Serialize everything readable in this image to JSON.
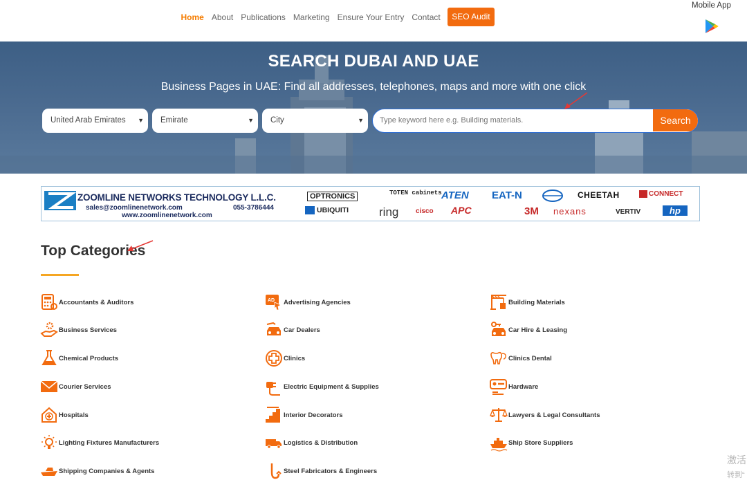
{
  "nav": {
    "links": [
      "Home",
      "About",
      "Publications",
      "Marketing",
      "Ensure Your Entry",
      "Contact"
    ],
    "seo_label": "SEO Audit",
    "mobile_app": "Mobile App"
  },
  "hero": {
    "title": "SEARCH DUBAI AND UAE",
    "subtitle": "Business Pages in UAE: Find all addresses, telephones, maps and more with one click",
    "country": "United Arab Emirates",
    "emirate": "Emirate",
    "city": "City",
    "search_placeholder": "Type keyword here e.g. Building materials.",
    "search_label": "Search"
  },
  "banner": {
    "company": "ZOOMLINE NETWORKS TECHNOLOGY L.L.C.",
    "email": "sales@zoomlinenetwork.com",
    "phone": "055-3786444",
    "web": "www.zoomlinenetwork.com",
    "brands_top": [
      "OPTRONICS",
      "TOTEN cabinets",
      "ATEN",
      "EAT-N",
      "CHEETAH",
      "CONNECT"
    ],
    "brands_bottom": [
      "UBIQUITI",
      "ring",
      "cisco",
      "APC",
      "3M",
      "nexans",
      "VERTIV",
      "hp"
    ]
  },
  "categories": {
    "title": "Top Categories",
    "items": [
      {
        "label": "Accountants & Auditors",
        "icon": "calculator-icon"
      },
      {
        "label": "Advertising Agencies",
        "icon": "advertising-icon"
      },
      {
        "label": "Building Materials",
        "icon": "crane-icon"
      },
      {
        "label": "Business Services",
        "icon": "hand-gear-icon"
      },
      {
        "label": "Car Dealers",
        "icon": "car-icon"
      },
      {
        "label": "Car Hire & Leasing",
        "icon": "car-key-icon"
      },
      {
        "label": "Chemical Products",
        "icon": "flask-icon"
      },
      {
        "label": "Clinics",
        "icon": "medical-cross-icon"
      },
      {
        "label": "Clinics Dental",
        "icon": "tooth-icon"
      },
      {
        "label": "Courier Services",
        "icon": "envelope-icon"
      },
      {
        "label": "Electric Equipment & Supplies",
        "icon": "plug-icon"
      },
      {
        "label": "Hardware",
        "icon": "tools-icon"
      },
      {
        "label": "Hospitals",
        "icon": "hospital-icon"
      },
      {
        "label": "Interior Decorators",
        "icon": "stairs-icon"
      },
      {
        "label": "Lawyers & Legal Consultants",
        "icon": "scales-icon"
      },
      {
        "label": "Lighting Fixtures Manufacturers",
        "icon": "bulb-icon"
      },
      {
        "label": "Logistics & Distribution",
        "icon": "truck-icon"
      },
      {
        "label": "Ship Store Suppliers",
        "icon": "ship-icon"
      },
      {
        "label": "Shipping Companies & Agents",
        "icon": "boat-icon"
      },
      {
        "label": "Steel Fabricators & Engineers",
        "icon": "hook-icon"
      }
    ]
  },
  "watermark": {
    "line1": "激活",
    "line2": "转到“"
  },
  "colors": {
    "accent": "#f26b0f",
    "hero": "#4a6a8f",
    "underline": "#f5a623"
  }
}
